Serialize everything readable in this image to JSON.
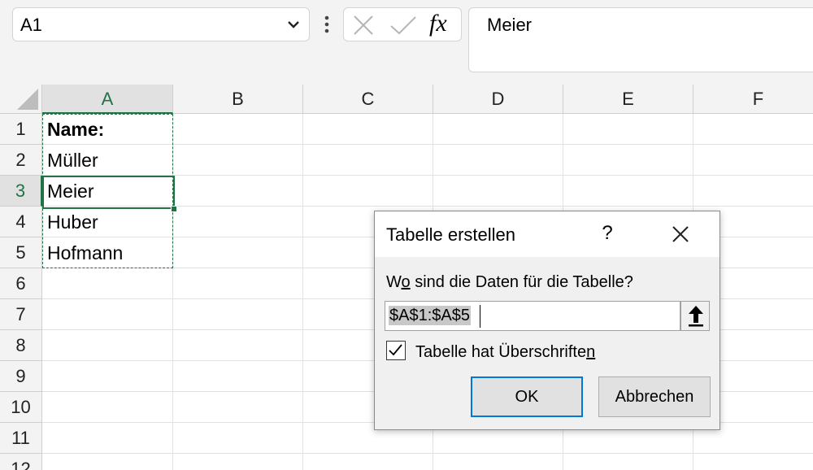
{
  "formula_bar": {
    "name_box": "A1",
    "formula_text": "Meier",
    "icons": [
      "chevron-down-icon",
      "vertical-dots-icon",
      "cancel-x-icon",
      "enter-check-icon",
      "insert-function-icon"
    ],
    "fx_label": "fx"
  },
  "grid": {
    "columns": [
      "A",
      "B",
      "C",
      "D",
      "E",
      "F"
    ],
    "rows": [
      "1",
      "2",
      "3",
      "4",
      "5",
      "6",
      "7",
      "8",
      "9",
      "10",
      "11",
      "12"
    ],
    "cells": {
      "A1": "Name:",
      "A2": "Müller",
      "A3": "Meier",
      "A4": "Huber",
      "A5": "Hofmann"
    },
    "active_column": "A",
    "active_row": "3",
    "accent_color": "#217346"
  },
  "dialog": {
    "title": "Tabelle erstellen",
    "help": "?",
    "question_prefix": "W",
    "question_underlined": "o",
    "question_rest": " sind die Daten für die Tabelle?",
    "range_value": "$A$1:$A$5",
    "checkbox_checked": true,
    "checkbox_label_main": "Tabelle hat Überschrifte",
    "checkbox_label_underlined": "n",
    "ok_label": "OK",
    "cancel_label": "Abbrechen",
    "focus_color": "#0078d7"
  }
}
